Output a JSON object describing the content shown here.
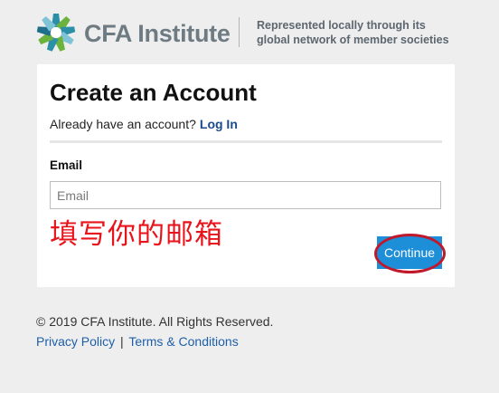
{
  "header": {
    "logo_text": "CFA Institute",
    "logo_icon": "cfa-globe-icon",
    "tagline_line1": "Represented locally through its",
    "tagline_line2": "global network of member societies"
  },
  "card": {
    "title": "Create an Account",
    "login_prompt": "Already have an account?",
    "login_link": "Log In",
    "email_label": "Email",
    "email_placeholder": "Email",
    "email_value": "",
    "annotation": "填写你的邮箱",
    "continue_label": "Continue"
  },
  "footer": {
    "copyright": "© 2019 CFA Institute. All Rights Reserved.",
    "privacy_link": "Privacy Policy",
    "separator": "|",
    "terms_link": "Terms & Conditions"
  },
  "colors": {
    "logo_teal": "#2b8fa8",
    "logo_green": "#6cb33e",
    "link_blue": "#1a4b8c",
    "button_blue": "#1d8ed8",
    "annotation_red": "#e8141b",
    "ring_red": "#c0192c"
  }
}
